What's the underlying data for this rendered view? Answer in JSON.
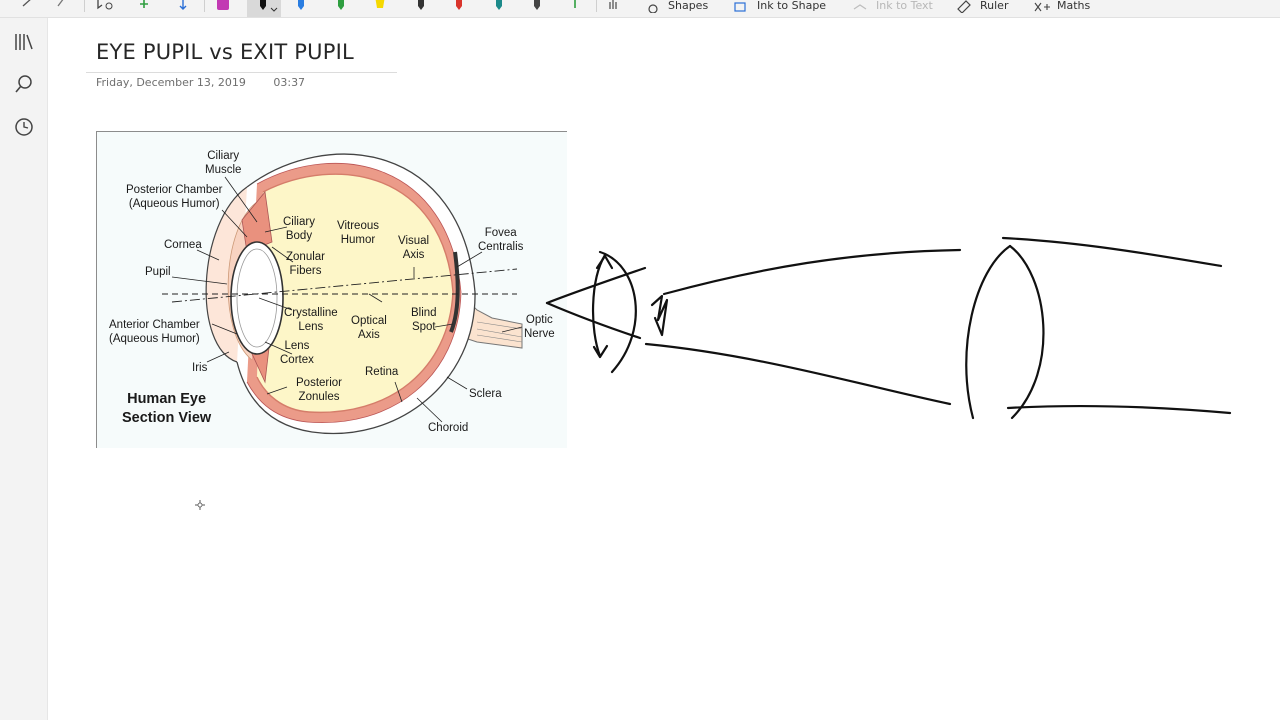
{
  "toolbar": {
    "shapes_label": "Shapes",
    "ink_to_shape_label": "Ink to Shape",
    "ink_to_text_label": "Ink to Text",
    "ruler_label": "Ruler",
    "maths_label": "Maths"
  },
  "page": {
    "title": "EYE PUPIL vs EXIT PUPIL",
    "date": "Friday, December 13, 2019",
    "time": "03:37"
  },
  "diagram": {
    "title_line1": "Human Eye",
    "title_line2": "Section View",
    "labels": {
      "ciliary_muscle": [
        "Ciliary",
        "Muscle"
      ],
      "posterior_chamber": [
        "Posterior Chamber",
        "(Aqueous Humor)"
      ],
      "cornea": "Cornea",
      "pupil": "Pupil",
      "anterior_chamber": [
        "Anterior Chamber",
        "(Aqueous Humor)"
      ],
      "iris": "Iris",
      "ciliary_body": [
        "Ciliary",
        "Body"
      ],
      "zonular_fibers": [
        "Zonular",
        "Fibers"
      ],
      "crystalline_lens": [
        "Crystalline",
        "Lens"
      ],
      "lens_cortex": [
        "Lens",
        "Cortex"
      ],
      "posterior_zonules": [
        "Posterior",
        "Zonules"
      ],
      "vitreous_humor": [
        "Vitreous",
        "Humor"
      ],
      "visual_axis": [
        "Visual",
        "Axis"
      ],
      "optical_axis": [
        "Optical",
        "Axis"
      ],
      "blind_spot": [
        "Blind",
        "Spot"
      ],
      "retina": "Retina",
      "fovea_centralis": [
        "Fovea",
        "Centralis"
      ],
      "optic_nerve": [
        "Optic",
        "Nerve"
      ],
      "sclera": "Sclera",
      "choroid": "Choroid"
    }
  },
  "colors": {
    "accent_pen": "#c239b3",
    "ink": "#111111",
    "sclera_fill": "#fdf6c8",
    "choroid": "#e98b7a"
  },
  "icons": {
    "rail": [
      "library-icon",
      "search-icon",
      "history-icon"
    ]
  }
}
